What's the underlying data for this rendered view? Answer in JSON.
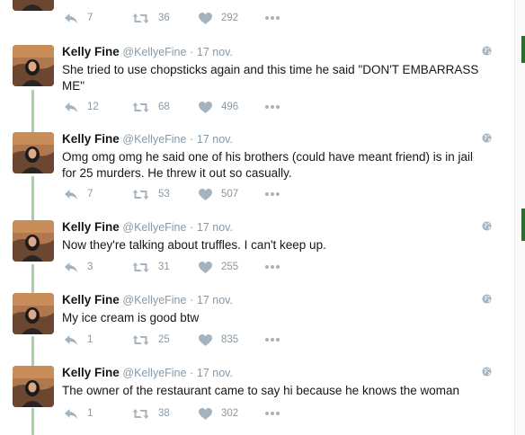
{
  "thread": {
    "top_partial": {
      "replies": "7",
      "retweets": "36",
      "likes": "292"
    },
    "tweets": [
      {
        "name": "Kelly Fine",
        "handle": "@KellyeFine",
        "separator": "·",
        "date": "17 nov.",
        "text": "She tried to use chopsticks again and this time he said \"DON'T EMBARRASS ME\"",
        "replies": "12",
        "retweets": "68",
        "likes": "496"
      },
      {
        "name": "Kelly Fine",
        "handle": "@KellyeFine",
        "separator": "·",
        "date": "17 nov.",
        "text": "Omg omg omg he said one of his brothers (could have meant friend) is in jail for 25 murders. He threw it out so casually.",
        "replies": "7",
        "retweets": "53",
        "likes": "507"
      },
      {
        "name": "Kelly Fine",
        "handle": "@KellyeFine",
        "separator": "·",
        "date": "17 nov.",
        "text": "Now they're talking about truffles. I can't keep up.",
        "replies": "3",
        "retweets": "31",
        "likes": "255"
      },
      {
        "name": "Kelly Fine",
        "handle": "@KellyeFine",
        "separator": "·",
        "date": "17 nov.",
        "text": "My ice cream is good btw",
        "replies": "1",
        "retweets": "25",
        "likes": "835"
      },
      {
        "name": "Kelly Fine",
        "handle": "@KellyeFine",
        "separator": "·",
        "date": "17 nov.",
        "text": "The owner of the restaurant came to say hi because he knows the woman",
        "replies": "1",
        "retweets": "38",
        "likes": "302"
      }
    ]
  },
  "icons": {
    "reply": "reply-icon",
    "retweet": "retweet-icon",
    "like": "heart-icon",
    "more": "more-dots-icon",
    "globe": "globe-icon"
  },
  "colors": {
    "thread_line": "#a6d2a0",
    "meta_gray": "#8899a6",
    "icon_gray": "#a5b3bf",
    "text": "#14171a"
  }
}
